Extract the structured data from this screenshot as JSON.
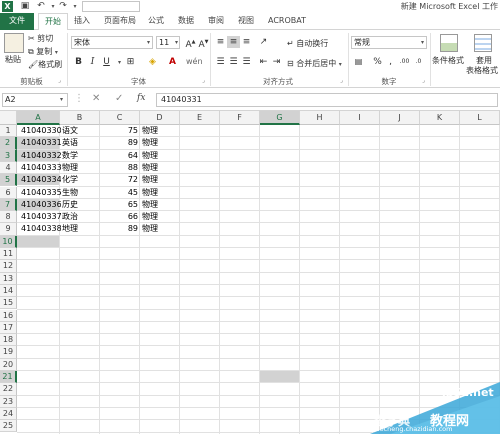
{
  "window": {
    "title": "新建 Microsoft Excel 工作"
  },
  "qat": {
    "save_icon": "save-icon",
    "undo_icon": "undo-icon",
    "redo_icon": "redo-icon"
  },
  "tabs": [
    {
      "label": "文件"
    },
    {
      "label": "开始"
    },
    {
      "label": "插入"
    },
    {
      "label": "页面布局"
    },
    {
      "label": "公式"
    },
    {
      "label": "数据"
    },
    {
      "label": "审阅"
    },
    {
      "label": "视图"
    },
    {
      "label": "ACROBAT"
    }
  ],
  "ribbon": {
    "clipboard": {
      "paste": "粘贴",
      "cut": "剪切",
      "copy": "复制",
      "format_painter": "格式刷",
      "label": "剪贴板"
    },
    "font": {
      "name": "宋体",
      "size": "11",
      "bold": "B",
      "italic": "I",
      "underline": "U",
      "font_color_glyph": "A",
      "label": "字体"
    },
    "alignment": {
      "wrap": "自动换行",
      "merge": "合并后居中",
      "label": "对齐方式"
    },
    "number": {
      "format": "常规",
      "label": "数字"
    },
    "styles": {
      "conditional": "条件格式",
      "table": "套用",
      "table2": "表格格式"
    }
  },
  "formula_bar": {
    "name_box": "A2",
    "fx": "fx",
    "value": "41040331"
  },
  "columns": [
    "A",
    "B",
    "C",
    "D",
    "E",
    "F",
    "G",
    "H",
    "I",
    "J",
    "K",
    "L"
  ],
  "rows": [
    "1",
    "2",
    "3",
    "4",
    "5",
    "6",
    "7",
    "8",
    "9",
    "10",
    "11",
    "12",
    "13",
    "14",
    "15",
    "16",
    "17",
    "18",
    "19",
    "20",
    "21",
    "22",
    "23",
    "24",
    "25"
  ],
  "data": [
    {
      "id": "41040330",
      "subject": "语文",
      "score": "75",
      "dept": "物理"
    },
    {
      "id": "41040331",
      "subject": "英语",
      "score": "89",
      "dept": "物理"
    },
    {
      "id": "41040332",
      "subject": "数学",
      "score": "64",
      "dept": "物理"
    },
    {
      "id": "41040333",
      "subject": "物理",
      "score": "88",
      "dept": "物理"
    },
    {
      "id": "41040334",
      "subject": "化学",
      "score": "72",
      "dept": "物理"
    },
    {
      "id": "41040335",
      "subject": "生物",
      "score": "45",
      "dept": "物理"
    },
    {
      "id": "41040336",
      "subject": "历史",
      "score": "65",
      "dept": "物理"
    },
    {
      "id": "41040337",
      "subject": "政治",
      "score": "66",
      "dept": "物理"
    },
    {
      "id": "41040338",
      "subject": "地理",
      "score": "89",
      "dept": "物理"
    }
  ],
  "watermark": {
    "line1": "查字典",
    "line2": "教程网",
    "site": "jb51.net",
    "url": "jiaocheng.chazidian.com"
  },
  "colors": {
    "accent": "#217346",
    "highlight": "#d2d2d2"
  }
}
